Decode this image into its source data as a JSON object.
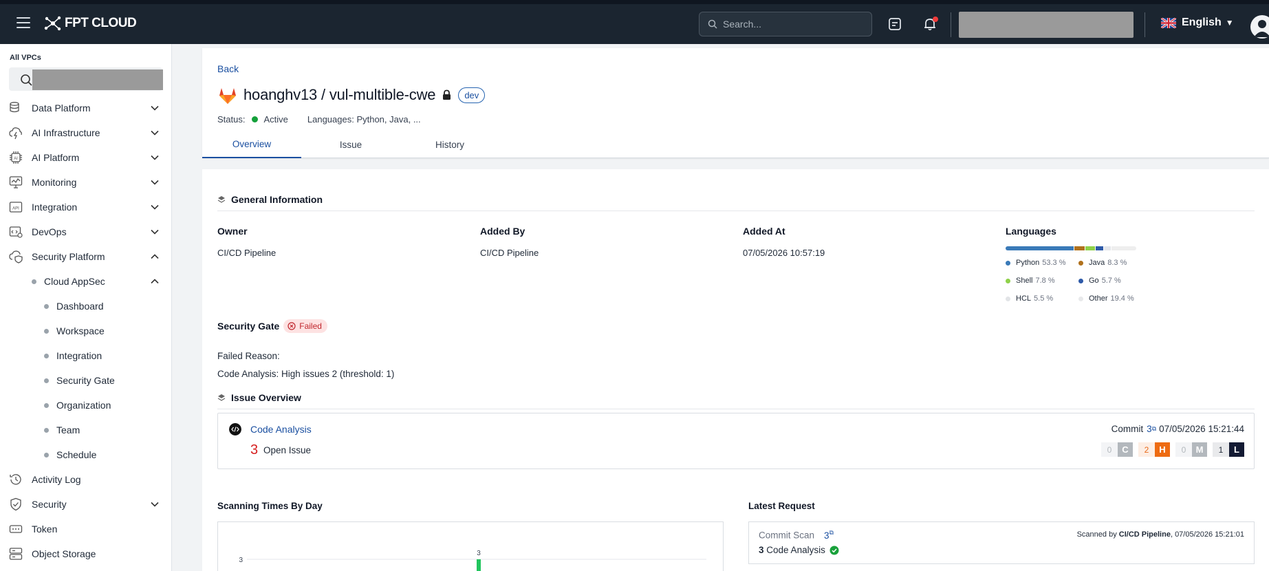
{
  "header": {
    "brand": "FPT CLOUD",
    "search_placeholder": "Search...",
    "language": "English"
  },
  "sidebar": {
    "vpc_label": "All VPCs",
    "items": [
      {
        "label": "Data Platform"
      },
      {
        "label": "AI Infrastructure"
      },
      {
        "label": "AI Platform"
      },
      {
        "label": "Monitoring"
      },
      {
        "label": "Integration"
      },
      {
        "label": "DevOps"
      },
      {
        "label": "Security Platform"
      },
      {
        "label": "Cloud AppSec"
      },
      {
        "label": "Dashboard"
      },
      {
        "label": "Workspace"
      },
      {
        "label": "Integration"
      },
      {
        "label": "Security Gate"
      },
      {
        "label": "Organization"
      },
      {
        "label": "Team"
      },
      {
        "label": "Schedule"
      },
      {
        "label": "Activity Log"
      },
      {
        "label": "Security"
      },
      {
        "label": "Token"
      },
      {
        "label": "Object Storage"
      }
    ]
  },
  "repo": {
    "back": "Back",
    "name": "hoanghv13 / vul-multible-cwe",
    "branch": "dev",
    "status_label": "Status:",
    "status": "Active",
    "languages_summary": "Languages: Python, Java, ...",
    "tabs": [
      "Overview",
      "Issue",
      "History"
    ]
  },
  "general": {
    "title": "General Information",
    "owner_label": "Owner",
    "owner": "CI/CD Pipeline",
    "added_by_label": "Added By",
    "added_by": "CI/CD Pipeline",
    "added_at_label": "Added At",
    "added_at": "07/05/2026 10:57:19",
    "languages_label": "Languages",
    "languages": [
      {
        "name": "Python",
        "pct": "53.3 %",
        "value": 53.3,
        "color": "#3a7ab8"
      },
      {
        "name": "Java",
        "pct": "8.3 %",
        "value": 8.3,
        "color": "#b0711c"
      },
      {
        "name": "Shell",
        "pct": "7.8 %",
        "value": 7.8,
        "color": "#8fd14a"
      },
      {
        "name": "Go",
        "pct": "5.7 %",
        "value": 5.7,
        "color": "#2e5aa8"
      },
      {
        "name": "HCL",
        "pct": "5.5 %",
        "value": 5.5,
        "color": "#e5e7eb"
      },
      {
        "name": "Other",
        "pct": "19.4 %",
        "value": 19.4,
        "color": "#eeeeee"
      }
    ]
  },
  "gate": {
    "label": "Security Gate",
    "status": "Failed",
    "reason_label": "Failed Reason:",
    "reason": "Code Analysis: High issues 2 (threshold: 1)"
  },
  "issue_overview": {
    "title": "Issue Overview",
    "tool": "Code Analysis",
    "open_count": "3",
    "open_label": "Open Issue",
    "commit_label": "Commit",
    "commit_id": "3",
    "commit_time": "07/05/2026 15:21:44",
    "severity": [
      {
        "count": "0",
        "letter": "C"
      },
      {
        "count": "2",
        "letter": "H"
      },
      {
        "count": "0",
        "letter": "M"
      },
      {
        "count": "1",
        "letter": "L"
      }
    ]
  },
  "scanning": {
    "title": "Scanning Times By Day"
  },
  "chart_data": {
    "type": "bar",
    "title": "Scanning Times By Day",
    "values": [
      3
    ],
    "data_labels": [
      "3"
    ],
    "y_ticks": [
      "3"
    ]
  },
  "latest": {
    "title": "Latest Request",
    "type": "Commit Scan",
    "commit_id": "3",
    "scanned_by_prefix": "Scanned by",
    "scanned_by": "CI/CD Pipeline",
    "scanned_at": ", 07/05/2026 15:21:01",
    "result_count": "3",
    "result_label": "Code Analysis"
  }
}
